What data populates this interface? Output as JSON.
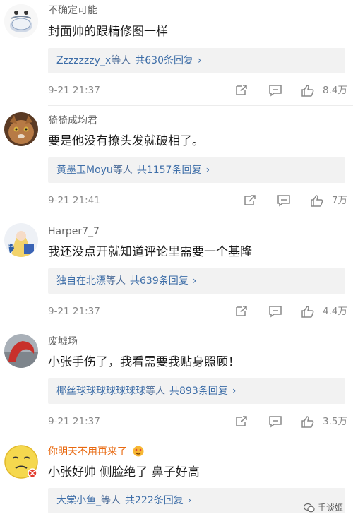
{
  "comments": [
    {
      "username": "不确定可能",
      "text": "封面帅的跟精修图一样",
      "reply_names": "Zzzzzzzy_x",
      "reply_suffix": "等人",
      "reply_count": "共630条回复",
      "time": "9-21 21:37",
      "likes": "8.4万"
    },
    {
      "username": "猗猗成均君",
      "text": "要是他没有撩头发就破相了。",
      "reply_names": "黄墨玉Moyu",
      "reply_suffix": "等人",
      "reply_count": "共1157条回复",
      "time": "9-21 21:41",
      "likes": "7万"
    },
    {
      "username": "Harper7_7",
      "text": "我还没点开就知道评论里需要一个基隆",
      "reply_names": "独自在北漂",
      "reply_suffix": "等人",
      "reply_count": "共639条回复",
      "time": "9-21 21:37",
      "likes": "4.4万"
    },
    {
      "username": "废墟场",
      "text": "小张手伤了，我看需要我贴身照顾！",
      "reply_names": "椰丝球球球球球球球",
      "reply_suffix": "等人",
      "reply_count": "共893条回复",
      "time": "9-21 21:37",
      "likes": "3.5万"
    },
    {
      "username": "你明天不用再来了",
      "text": "小张好帅 侧脸绝了 鼻子好高",
      "reply_names": "大棠小鱼_",
      "reply_suffix": "等人",
      "reply_count": "共222条回复",
      "time": "",
      "likes": ""
    }
  ],
  "icons": {
    "share": "share-icon",
    "comment": "comment-icon",
    "like": "thumbs-up-icon",
    "chevron": "chevron-right-icon"
  },
  "watermark": "手谈姬",
  "colors": {
    "link": "#3e6ea8",
    "meta": "#888888",
    "vip_name": "#e8680f",
    "reply_bg": "#f2f2f2"
  }
}
